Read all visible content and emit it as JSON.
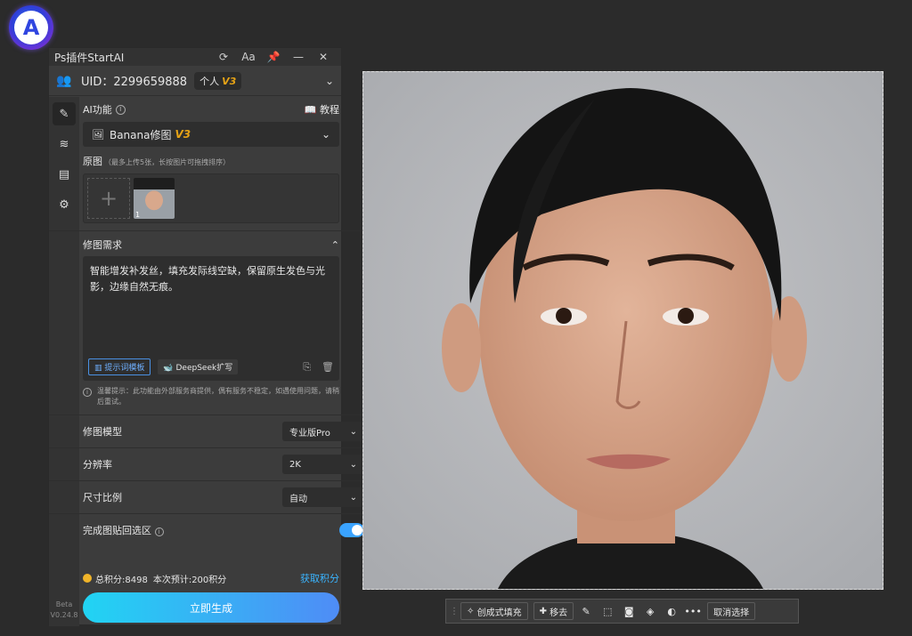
{
  "app": {
    "logo_letter": "A"
  },
  "panel": {
    "title": "Ps插件StartAI",
    "title_icons": [
      "refresh-icon",
      "font-size-icon",
      "pin-icon",
      "minimize-icon",
      "close-icon"
    ],
    "uid": "UID：2299659888",
    "plan_badge": "个人",
    "plan_version": "V3"
  },
  "rail": {
    "items": [
      "edit-icon",
      "layers-icon",
      "clipboard-icon",
      "settings-icon"
    ],
    "version_line1": "Beta",
    "version_line2": "V0.24.8"
  },
  "ai": {
    "label": "AI功能",
    "tutorial": "教程",
    "selected": "Banana修图",
    "selected_version": "V3"
  },
  "original": {
    "label": "原图",
    "hint": "（最多上传5张，长按图片可拖拽排序）",
    "add": "+",
    "thumb_index": "1"
  },
  "requirement": {
    "label": "修图需求",
    "text": "智能增发补发丝，填充发际线空缺，保留原生发色与光影，边缘自然无痕。",
    "template_button": "提示词模板",
    "deepseek_button": "DeepSeek扩写",
    "notice": "温馨提示：此功能由外部服务商提供，偶有服务不稳定，如遇使用问题，请稍后重试。"
  },
  "fields": {
    "model_label": "修图模型",
    "model_value": "专业版Pro",
    "resolution_label": "分辨率",
    "resolution_value": "2K",
    "ratio_label": "尺寸比例",
    "ratio_value": "自动",
    "paste_label": "完成图贴回选区",
    "paste_on": true
  },
  "points": {
    "total": "总积分:8498",
    "estimate": "本次预计:200积分",
    "get": "获取积分"
  },
  "generate": "立即生成",
  "toolbar": {
    "generative_fill": "创成式填充",
    "remove": "移去",
    "cancel_selection": "取消选择",
    "more": "•••"
  }
}
